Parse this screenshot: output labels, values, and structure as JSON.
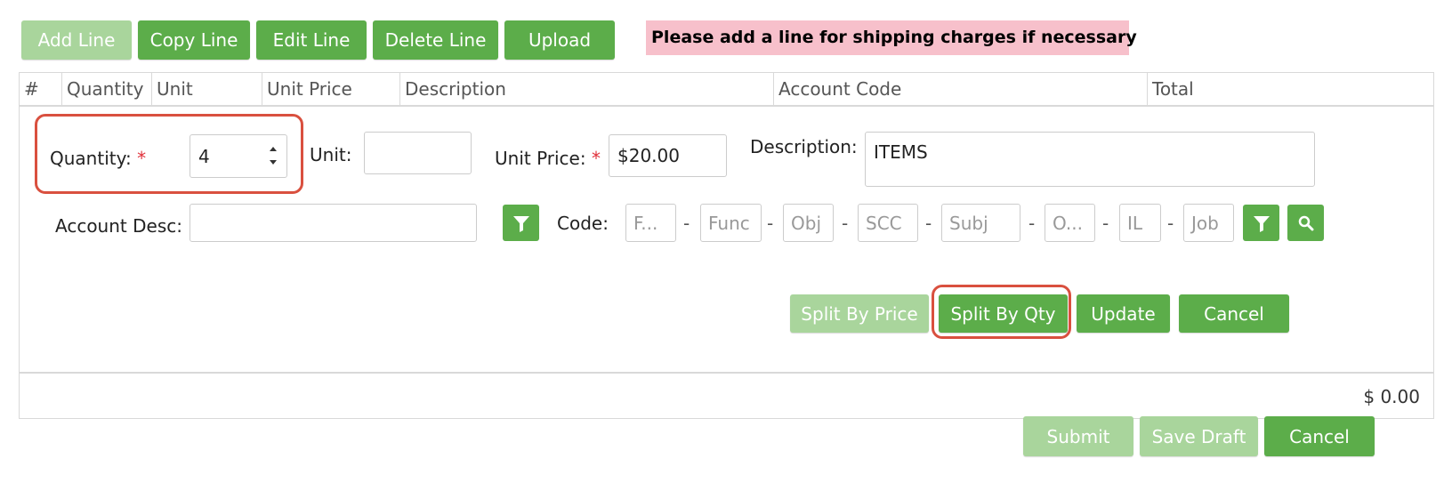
{
  "toolbar": {
    "add_line": "Add Line",
    "copy_line": "Copy Line",
    "edit_line": "Edit Line",
    "delete_line": "Delete Line",
    "upload": "Upload",
    "notice": "Please add a line for shipping charges if necessary"
  },
  "grid": {
    "columns": [
      "#",
      "Quantity",
      "Unit",
      "Unit Price",
      "Description",
      "Account Code",
      "Total"
    ],
    "total": "$ 0.00"
  },
  "edit_form": {
    "quantity_label": "Quantity:",
    "quantity_value": "4",
    "unit_label": "Unit:",
    "unit_value": "",
    "unit_price_label": "Unit Price:",
    "unit_price_value": "$20.00",
    "description_label": "Description:",
    "description_value": "ITEMS",
    "account_desc_label": "Account Desc:",
    "account_desc_value": "",
    "code_label": "Code:",
    "code_placeholders": [
      "F...",
      "Func",
      "Obj",
      "SCC",
      "Subj",
      "O...",
      "IL",
      "Job"
    ],
    "dash": "-",
    "required_mark": "*",
    "split_by_price": "Split By Price",
    "split_by_qty": "Split By Qty",
    "update": "Update",
    "cancel": "Cancel"
  },
  "footer": {
    "submit": "Submit",
    "save_draft": "Save Draft",
    "cancel": "Cancel"
  },
  "colors": {
    "primary_green": "#5cad4a",
    "disabled_green": "#a9d59c",
    "notice_bg": "#f7c0cb",
    "highlight": "#d9503f"
  }
}
